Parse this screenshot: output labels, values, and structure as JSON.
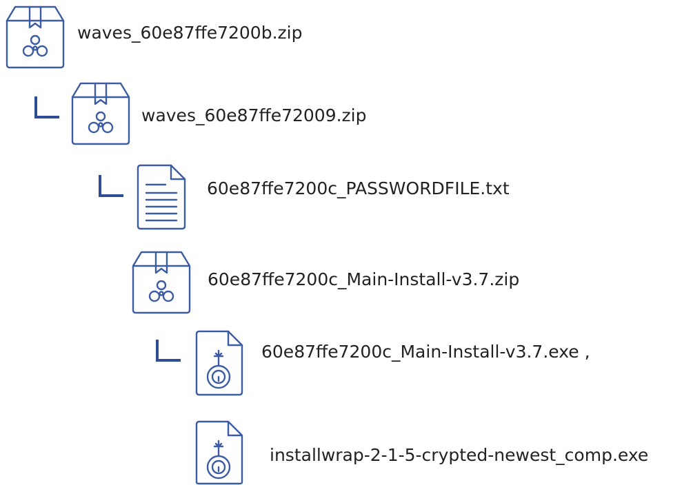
{
  "tree": {
    "items": [
      {
        "name": "waves_60e87ffe7200b.zip",
        "type": "zip-archive",
        "icon": "biohazard-package-icon"
      },
      {
        "name": "waves_60e87ffe72009.zip",
        "type": "zip-archive",
        "icon": "biohazard-package-icon"
      },
      {
        "name": "60e87ffe7200c_PASSWORDFILE.txt",
        "type": "text-file",
        "icon": "text-document-icon"
      },
      {
        "name": "60e87ffe7200c_Main-Install-v3.7.zip",
        "type": "zip-archive",
        "icon": "biohazard-package-icon"
      },
      {
        "name": "60e87ffe7200c_Main-Install-v3.7.exe ,",
        "type": "executable",
        "icon": "bomb-file-icon"
      },
      {
        "name": "installwrap-2-1-5-crypted-newest_comp.exe",
        "type": "executable",
        "icon": "bomb-file-icon"
      }
    ]
  },
  "colors": {
    "icon_stroke": "#3b5ba3",
    "text": "#222222"
  }
}
